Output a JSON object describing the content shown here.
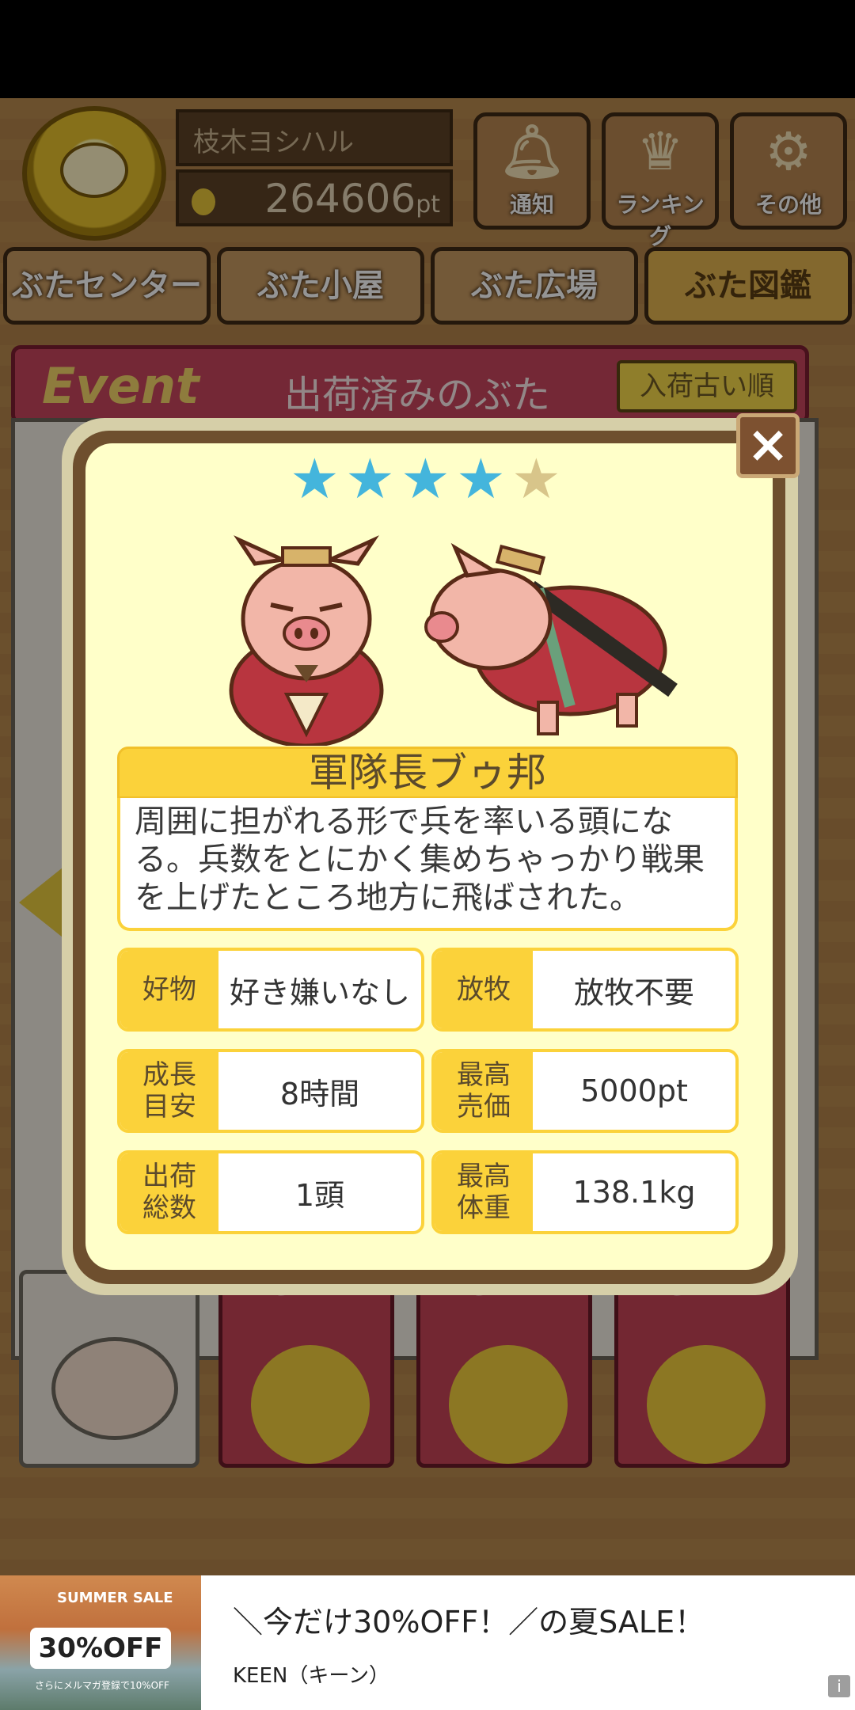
{
  "header": {
    "player_name": "枝木ヨシハル",
    "points": "264606",
    "points_unit": "pt"
  },
  "top_buttons": [
    {
      "label": "通知",
      "icon": "bell-icon"
    },
    {
      "label": "ランキング",
      "icon": "crown-icon"
    },
    {
      "label": "その他",
      "icon": "gear-icon"
    }
  ],
  "nav_tabs": [
    "ぶたセンター",
    "ぶた小屋",
    "ぶた広場",
    "ぶた図鑑"
  ],
  "event_bar": {
    "event_label": "Event",
    "title": "出荷済みのぶた",
    "sort_label": "入荷古い順"
  },
  "categories": [
    {
      "event_label": "Event"
    },
    {
      "event_label": "Event"
    },
    {
      "event_label": "Event"
    }
  ],
  "popup": {
    "rating": 4,
    "rating_max": 5,
    "close_label": "×",
    "pig_name": "軍隊長ブゥ邦",
    "description": [
      "周囲に担がれる形で兵を率いる頭にな",
      "る。兵数をとにかく集めちゃっかり戦果",
      "を上げたところ地方に飛ばされた。"
    ],
    "stats": [
      {
        "key": "好物",
        "value": "好き嫌いなし"
      },
      {
        "key": "放牧",
        "value": "放牧不要"
      },
      {
        "key": "成長\n目安",
        "value": "8時間"
      },
      {
        "key": "最高\n売価",
        "value": "5000pt"
      },
      {
        "key": "出荷\n総数",
        "value": "1頭"
      },
      {
        "key": "最高\n体重",
        "value": "138.1kg"
      }
    ]
  },
  "ad": {
    "image_top_text": "SUMMER SALE",
    "image_big_text": "30%OFF",
    "image_small_text": "さらにメルマガ登録で10%OFF",
    "title": "＼今だけ30%OFF！／の夏SALE！",
    "subtitle": "KEEN（キーン）",
    "info_label": "i"
  }
}
